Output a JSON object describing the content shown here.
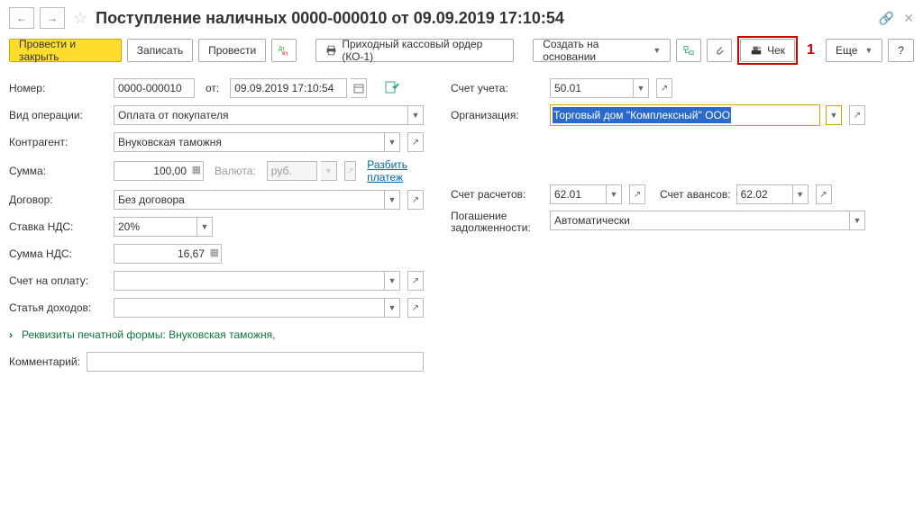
{
  "title": "Поступление наличных 0000-000010 от 09.09.2019 17:10:54",
  "toolbar": {
    "submit_close": "Провести и закрыть",
    "save": "Записать",
    "submit": "Провести",
    "print_ko1": "Приходный кассовый ордер (КО-1)",
    "create_based": "Создать на основании",
    "check": "Чек",
    "more": "Еще",
    "help": "?"
  },
  "callout": "1",
  "left": {
    "number_lbl": "Номер:",
    "number": "0000-000010",
    "from_lbl": "от:",
    "date": "09.09.2019 17:10:54",
    "op_type_lbl": "Вид операции:",
    "op_type": "Оплата от покупателя",
    "contractor_lbl": "Контрагент:",
    "contractor": "Внуковская таможня",
    "sum_lbl": "Сумма:",
    "sum": "100,00",
    "currency_lbl": "Валюта:",
    "currency": "руб.",
    "split_payment": "Разбить платеж",
    "contract_lbl": "Договор:",
    "contract": "Без договора",
    "vat_rate_lbl": "Ставка НДС:",
    "vat_rate": "20%",
    "vat_sum_lbl": "Сумма НДС:",
    "vat_sum": "16,67",
    "invoice_lbl": "Счет на оплату:",
    "income_lbl": "Статья доходов:",
    "print_req": "Реквизиты печатной формы: Внуковская таможня,",
    "comment_lbl": "Комментарий:"
  },
  "right": {
    "account_lbl": "Счет учета:",
    "account": "50.01",
    "org_lbl": "Организация:",
    "org": "Торговый дом \"Комплексный\" ООО",
    "settle_acc_lbl": "Счет расчетов:",
    "settle_acc": "62.01",
    "advance_acc_lbl": "Счет авансов:",
    "advance_acc": "62.02",
    "debt_lbl": "Погашение задолженности:",
    "debt": "Автоматически"
  }
}
